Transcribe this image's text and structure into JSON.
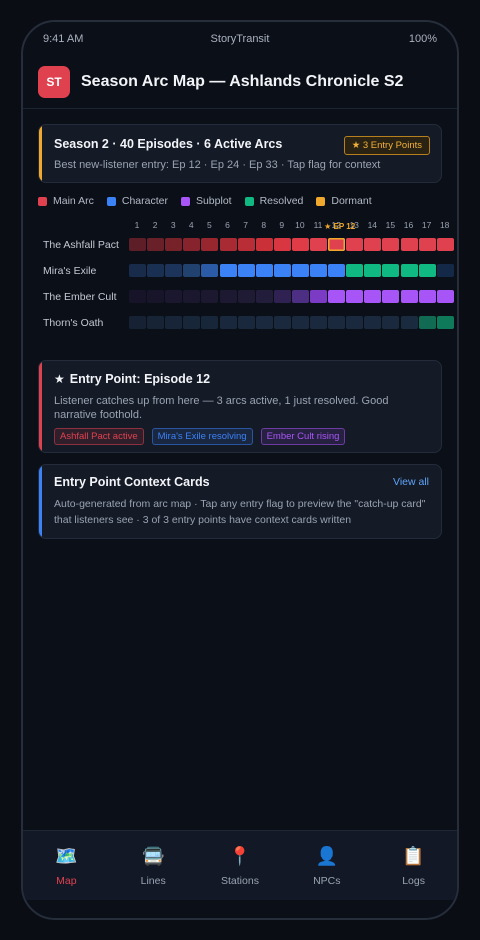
{
  "status_bar": {
    "time": "9:41 AM",
    "app_name": "StoryTransit",
    "battery": "100%"
  },
  "header": {
    "logo_text": "ST",
    "title": "Season Arc Map — Ashlands Chronicle S2"
  },
  "season_card": {
    "title": "Season 2 · 40 Episodes · 6 Active Arcs",
    "subtitle": "Best new-listener entry: Ep 12 · Ep 24 · Ep 33 · Tap flag for context",
    "badge": "3 Entry Points",
    "badge_icon": "star-icon"
  },
  "legend": [
    {
      "label": "Main Arc",
      "color": "#e0414f"
    },
    {
      "label": "Character",
      "color": "#3b82f6"
    },
    {
      "label": "Subplot",
      "color": "#a855f7"
    },
    {
      "label": "Resolved",
      "color": "#10b981"
    },
    {
      "label": "Dormant",
      "color": "#f0a92c"
    }
  ],
  "arc_map": {
    "episodes": [
      "1",
      "2",
      "3",
      "4",
      "5",
      "6",
      "7",
      "8",
      "9",
      "10",
      "11",
      "12",
      "13",
      "14",
      "15",
      "16",
      "17",
      "18"
    ],
    "entry_marker": {
      "label": "EP 12",
      "icon": "star-icon",
      "episode_index": 11
    },
    "arcs": [
      {
        "name": "The Ashfall Pact",
        "cells": [
          "#5d1e27",
          "#6a2029",
          "#772129",
          "#87232c",
          "#98262f",
          "#a82a33",
          "#b92d37",
          "#c93038",
          "#d83640",
          "#df3c47",
          "#e0414f",
          "#e0414f",
          "#e0414f",
          "#e0414f",
          "#e0414f",
          "#e0414f",
          "#e0414f",
          "#e0414f"
        ]
      },
      {
        "name": "Mira's Exile",
        "cells": [
          "#182b4b",
          "#1a3052",
          "#1c345a",
          "#21416f",
          "#2b5ba6",
          "#3b82f6",
          "#3b82f6",
          "#3b82f6",
          "#3b82f6",
          "#3b82f6",
          "#3b82f6",
          "#3b82f6",
          "#10b981",
          "#10b981",
          "#10b981",
          "#10b981",
          "#10b981",
          "#132947"
        ]
      },
      {
        "name": "The Ember Cult",
        "cells": [
          "#171429",
          "#18152b",
          "#1a172e",
          "#1a172e",
          "#1c1830",
          "#1d1932",
          "#1f1b35",
          "#221d3b",
          "#2f2253",
          "#4c2f83",
          "#7c3bc5",
          "#a855f7",
          "#a855f7",
          "#a855f7",
          "#a855f7",
          "#a855f7",
          "#a855f7",
          "#a855f7"
        ]
      },
      {
        "name": "Thorn's Oath",
        "cells": [
          "#162233",
          "#172436",
          "#182538",
          "#18263a",
          "#18263a",
          "#19283c",
          "#19283c",
          "#1a293d",
          "#1a293d",
          "#1a293d",
          "#1a293d",
          "#1a293d",
          "#1a293d",
          "#1a293d",
          "#1a293d",
          "#1a2b40",
          "#116b52",
          "#0f7a5a"
        ]
      }
    ]
  },
  "entry_card": {
    "icon": "star-icon",
    "title": "Entry Point: Episode 12",
    "description": "Listener catches up from here — 3 arcs active, 1 just resolved. Good narrative foothold.",
    "tags": [
      {
        "label": "Ashfall Pact active",
        "color": "#e0414f"
      },
      {
        "label": "Mira's Exile resolving",
        "color": "#3b82f6"
      },
      {
        "label": "Ember Cult rising",
        "color": "#a855f7"
      }
    ]
  },
  "context_card": {
    "title": "Entry Point Context Cards",
    "view_all": "View all",
    "description": "Auto-generated from arc map · Tap any entry flag to preview the \"catch-up card\" that listeners see · 3 of 3 entry points have context cards written"
  },
  "tab_bar": [
    {
      "label": "Map",
      "icon": "map-icon",
      "glyph": "🗺️",
      "active": true
    },
    {
      "label": "Lines",
      "icon": "bus-icon",
      "glyph": "🚍",
      "active": false
    },
    {
      "label": "Stations",
      "icon": "pin-icon",
      "glyph": "📍",
      "active": false
    },
    {
      "label": "NPCs",
      "icon": "person-icon",
      "glyph": "👤",
      "active": false
    },
    {
      "label": "Logs",
      "icon": "clipboard-icon",
      "glyph": "📋",
      "active": false
    }
  ]
}
